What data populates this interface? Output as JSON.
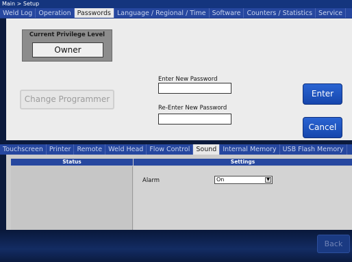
{
  "breadcrumb": "Main > Setup",
  "top_tabs": [
    {
      "label": "Weld Log",
      "active": false
    },
    {
      "label": "Operation",
      "active": false
    },
    {
      "label": "Passwords",
      "active": true
    },
    {
      "label": "Language / Regional / Time",
      "active": false
    },
    {
      "label": "Software",
      "active": false
    },
    {
      "label": "Counters / Statistics",
      "active": false
    },
    {
      "label": "Service",
      "active": false
    }
  ],
  "privilege": {
    "label": "Current Privilege Level",
    "value": "Owner"
  },
  "change_programmer": {
    "label": "Change Programmer",
    "enabled": false
  },
  "password": {
    "new_label": "Enter New Password",
    "new_value": "",
    "reenter_label": "Re-Enter New Password",
    "reenter_value": ""
  },
  "enter_button": "Enter",
  "cancel_button": "Cancel",
  "sub_tabs": [
    {
      "label": "Touchscreen",
      "active": false
    },
    {
      "label": "Printer",
      "active": false
    },
    {
      "label": "Remote",
      "active": false
    },
    {
      "label": "Weld Head",
      "active": false
    },
    {
      "label": "Flow Control",
      "active": false
    },
    {
      "label": "Sound",
      "active": true
    },
    {
      "label": "Internal Memory",
      "active": false
    },
    {
      "label": "USB Flash Memory",
      "active": false
    }
  ],
  "columns": {
    "status": "Status",
    "settings": "Settings"
  },
  "alarm": {
    "label": "Alarm",
    "value": "On"
  },
  "back_button": "Back",
  "colors": {
    "accent_blue": "#1646ad",
    "tab_bar": "#26479f",
    "active_tab": "#e9e9e9",
    "background": "#0b1a3c"
  }
}
